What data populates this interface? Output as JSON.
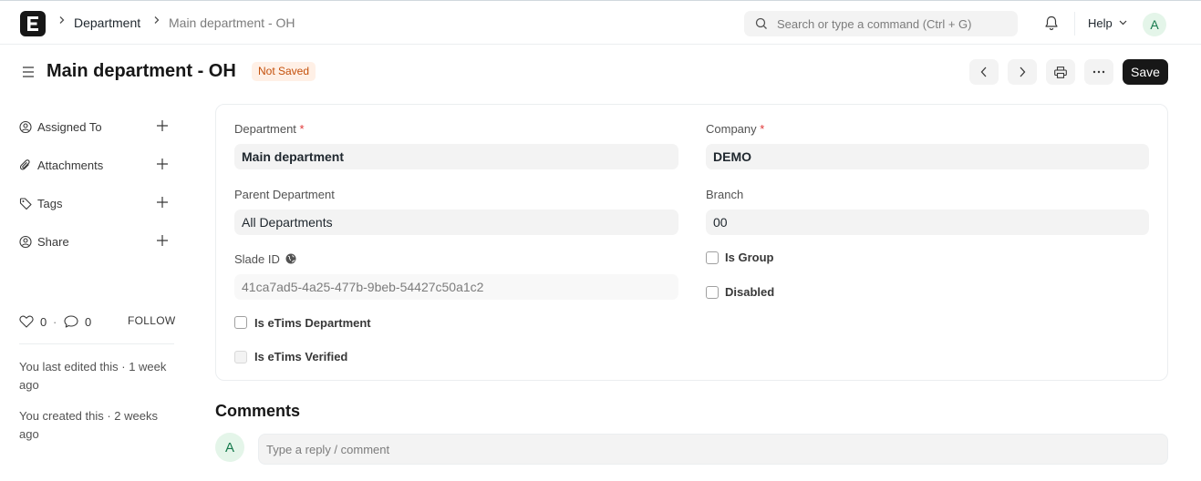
{
  "navbar": {
    "logo_letter": "E",
    "breadcrumbs": [
      "Department",
      "Main department - OH"
    ],
    "search_placeholder": "Search or type a command (Ctrl + G)",
    "help_label": "Help",
    "avatar_initial": "A"
  },
  "header": {
    "title": "Main department - OH",
    "status_badge": "Not Saved",
    "save_label": "Save"
  },
  "sidebar": {
    "items": [
      {
        "label": "Assigned To",
        "icon": "assign-icon"
      },
      {
        "label": "Attachments",
        "icon": "paperclip-icon"
      },
      {
        "label": "Tags",
        "icon": "tag-icon"
      },
      {
        "label": "Share",
        "icon": "share-icon"
      }
    ],
    "likes_count": "0",
    "comments_count": "0",
    "follow_label": "FOLLOW",
    "last_edited": "You last edited this · 1 week ago",
    "created": "You created this · 2 weeks ago"
  },
  "form": {
    "department_label": "Department",
    "department_value": "Main department",
    "company_label": "Company",
    "company_value": "DEMO",
    "parent_label": "Parent Department",
    "parent_value": "All Departments",
    "branch_label": "Branch",
    "branch_value": "00",
    "slade_label": "Slade ID",
    "slade_value": "41ca7ad5-4a25-477b-9beb-54427c50a1c2",
    "is_group_label": "Is Group",
    "disabled_label": "Disabled",
    "etims_dept_label": "Is eTims Department",
    "etims_verified_label": "Is eTims Verified",
    "required_mark": "*"
  },
  "comments": {
    "title": "Comments",
    "avatar_initial": "A",
    "placeholder": "Type a reply / comment"
  },
  "colors": {
    "accent_dark": "#171717",
    "badge_bg": "#fff0e6",
    "badge_text": "#c4500b",
    "avatar_bg": "#e4f5e9",
    "avatar_text": "#16794c",
    "required": "#e03636"
  }
}
